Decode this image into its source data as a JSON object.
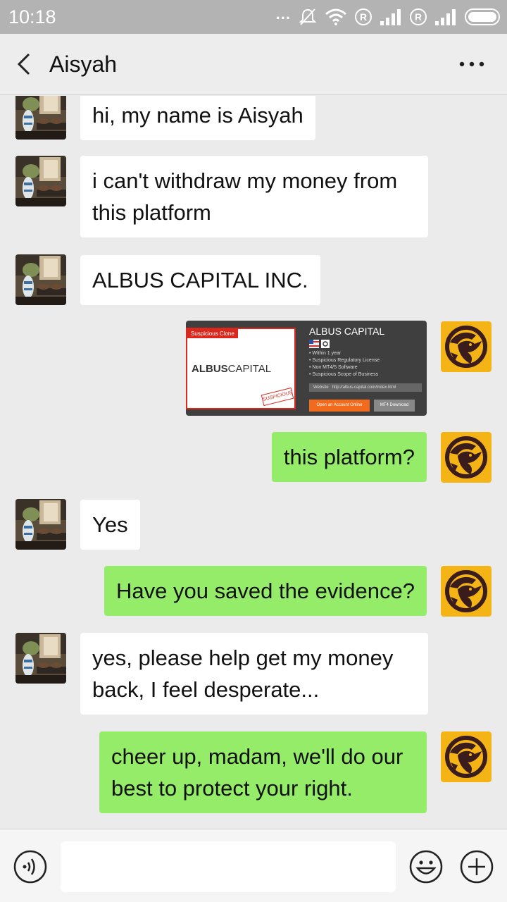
{
  "status_bar": {
    "time": "10:18",
    "dots": "...",
    "r_badge": "R"
  },
  "header": {
    "title": "Aisyah"
  },
  "messages": {
    "m1": "hi, my name is Aisyah",
    "m2": "i can't withdraw my money from this platform",
    "m3": "ALBUS CAPITAL INC.",
    "image": {
      "tag": "Suspicious Clone",
      "logo_bold": "ALBUS",
      "logo_light": "CAPITAL",
      "stamp": "SUSPICIOUS",
      "title": "ALBUS CAPITAL",
      "list": [
        "• Within 1 year",
        "• Suspicious Regulatory License",
        "• Non MT4/5 Software",
        "• Suspicious Scope of Business"
      ],
      "url_label": "Website",
      "url": "http://albus-capital.com/index.html",
      "btn_open": "Open an Account Online",
      "btn_download": "MT4 Download"
    },
    "m4": "this platform?",
    "m5": "Yes",
    "m6": "Have you saved the evidence?",
    "m7": "yes, please help get my money back, I feel desperate...",
    "m8": "cheer up, madam, we'll do our best to protect your right."
  },
  "input": {
    "placeholder": ""
  },
  "colors": {
    "outgoing_bubble": "#95ec69",
    "incoming_bubble": "#ffffff",
    "background": "#ebebeb",
    "agent_avatar": "#f5b416"
  },
  "icons": {
    "back": "chevron-left-icon",
    "more": "more-dots-icon",
    "voice": "voice-icon",
    "emoji": "emoji-icon",
    "plus": "plus-icon",
    "wifi": "wifi-icon",
    "mute": "mute-bell-icon",
    "signal": "signal-icon",
    "battery": "battery-icon"
  }
}
